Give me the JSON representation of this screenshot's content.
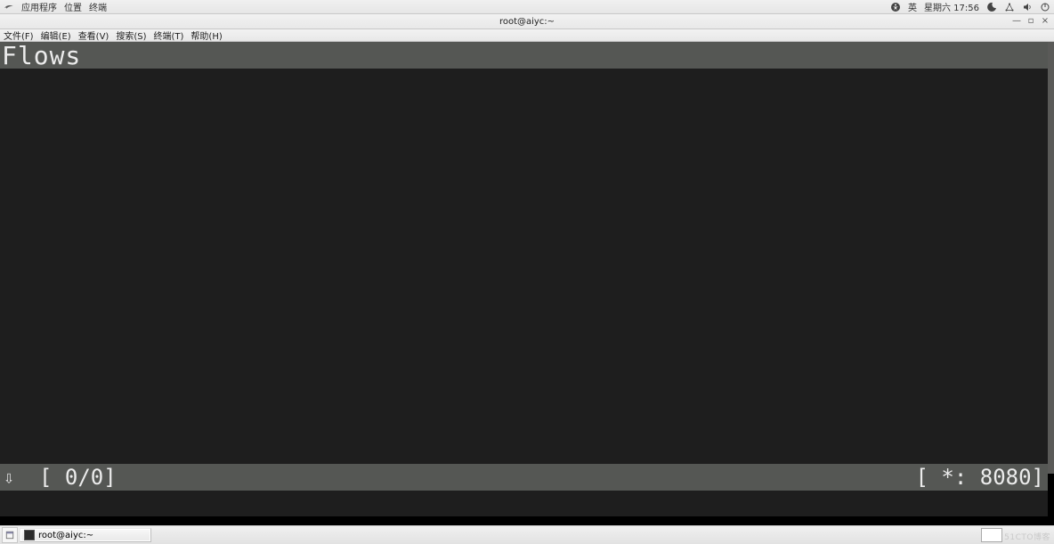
{
  "panel": {
    "apps": "应用程序",
    "places": "位置",
    "terminal": "终端",
    "lang": "英",
    "clock": "星期六 17:56"
  },
  "window": {
    "title": "root@aiyc:~",
    "min": "—",
    "max": "▫",
    "close": "×"
  },
  "menu": {
    "file": "文件(F)",
    "edit": "编辑(E)",
    "view": "查看(V)",
    "search": "搜索(S)",
    "terminal": "终端(T)",
    "help": "帮助(H)"
  },
  "mitm": {
    "header": "Flows",
    "arrow": "⇩",
    "counter": "[ 0/0]",
    "listen": "[ *: 8080]"
  },
  "taskbar": {
    "task1": "root@aiyc:~",
    "watermark": "51CTO博客"
  }
}
